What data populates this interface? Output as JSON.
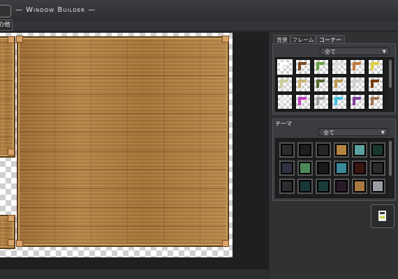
{
  "window": {
    "title": "— Window Builder —",
    "tool_button_label": "の他"
  },
  "tabs": [
    {
      "label": "背景",
      "active": false
    },
    {
      "label": "フレーム",
      "active": false
    },
    {
      "label": "コーナー",
      "active": true
    }
  ],
  "corner_panel": {
    "filter_value": "全て"
  },
  "theme_panel": {
    "title": "テーマ",
    "filter_value": "全て"
  },
  "colors": {
    "background": "#2b2d2f",
    "wood": "#a87a3f",
    "theme_swatches": [
      "#2b2b2b",
      "#1e1e1e",
      "#262626",
      "#b5853f",
      "#5aa3a0",
      "#17382f",
      "#2e3140",
      "#4b8a58",
      "#1a1a1a",
      "#3a8a9a",
      "#3b1512",
      "#2a2a2a",
      "#2c2c30",
      "#17383a",
      "#1c3c3c",
      "#2a1a28",
      "#a87a3f",
      "#9a9ea4"
    ]
  },
  "icons": {
    "save": "save-icon",
    "dropdown": "chevron-down-icon"
  }
}
